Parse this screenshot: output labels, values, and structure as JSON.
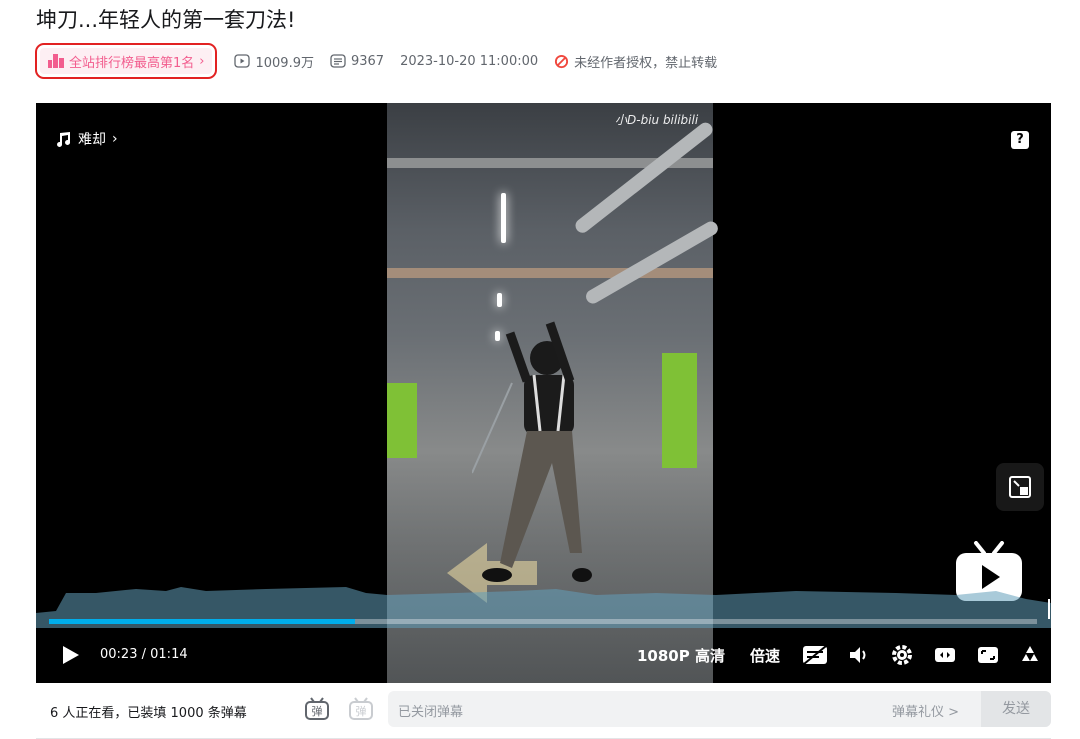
{
  "video": {
    "title": "坤刀...年轻人的第一套刀法!"
  },
  "meta": {
    "rank_badge": "全站排行榜最高第1名",
    "views": "1009.9万",
    "danmaku_count": "9367",
    "publish_time": "2023-10-20 11:00:00",
    "copyright_notice": "未经作者授权，禁止转载"
  },
  "player": {
    "song_label": "难却",
    "watermark": "小D-biu bilibili",
    "current_time": "00:23",
    "time_separator": "/",
    "duration": "01:14",
    "progress_fraction": 0.31,
    "quality_label": "1080P 高清",
    "speed_label": "倍速"
  },
  "danmaku_bar": {
    "viewers_text": "6 人正在看，已装填 1000 条弹幕",
    "input_placeholder": "已关闭弹幕",
    "etiquette_link": "弹幕礼仪 >",
    "send_button": "发送"
  },
  "colors": {
    "accent_blue": "#00aeec",
    "rank_pink": "#f25d8e",
    "highlight_red": "#e22222"
  },
  "icons": {
    "rank": "bar-chart-icon",
    "views": "play-count-icon",
    "danmaku": "danmaku-count-icon",
    "copyright": "prohibited-icon",
    "music": "music-note-icon",
    "help": "question-icon",
    "pip": "picture-in-picture-icon",
    "play": "play-icon",
    "danmaku_toggle": "danmaku-toggle-icon",
    "volume": "volume-icon",
    "settings": "gear-icon",
    "widescreen": "widescreen-icon",
    "fullscreen": "fullscreen-icon",
    "dm_style": "danmaku-style-icon"
  }
}
